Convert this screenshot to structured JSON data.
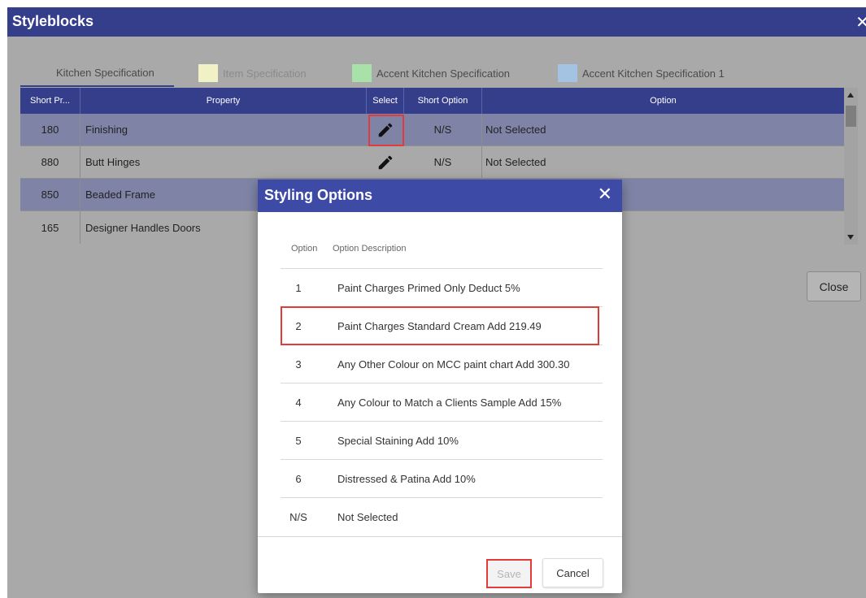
{
  "window": {
    "title": "Styleblocks",
    "close_glyph": "✕"
  },
  "tabs": [
    {
      "label": "Kitchen Specification",
      "color": ""
    },
    {
      "label": "Item Specification",
      "color": "#f1f1c6"
    },
    {
      "label": "Accent Kitchen Specification",
      "color": "#a9e2a9"
    },
    {
      "label": "Accent Kitchen Specification 1",
      "color": "#a4c3e2"
    }
  ],
  "grid": {
    "columns": [
      "Short Pr...",
      "Property",
      "Select",
      "Short Option",
      "Option"
    ],
    "rows": [
      {
        "short": "180",
        "property": "Finishing",
        "short_option": "N/S",
        "option": "Not Selected",
        "selected": true
      },
      {
        "short": "880",
        "property": "Butt Hinges",
        "short_option": "N/S",
        "option": "Not Selected",
        "selected": false
      },
      {
        "short": "850",
        "property": "Beaded Frame",
        "short_option": "",
        "option": "",
        "selected": true
      },
      {
        "short": "165",
        "property": "Designer Handles Doors",
        "short_option": "",
        "option": "",
        "selected": false
      }
    ]
  },
  "close_button": "Close",
  "modal": {
    "title": "Styling Options",
    "close_glyph": "✕",
    "headers": {
      "option": "Option",
      "description": "Option Description"
    },
    "options": [
      {
        "option": "1",
        "description": "Paint Charges Primed Only Deduct 5%"
      },
      {
        "option": "2",
        "description": "Paint Charges Standard Cream Add 219.49"
      },
      {
        "option": "3",
        "description": "Any Other Colour on MCC paint chart Add 300.30"
      },
      {
        "option": "4",
        "description": "Any Colour to Match a Clients Sample Add 15%"
      },
      {
        "option": "5",
        "description": "Special Staining Add 10%"
      },
      {
        "option": "6",
        "description": "Distressed & Patina Add 10%"
      },
      {
        "option": "N/S",
        "description": "Not Selected"
      }
    ],
    "save_label": "Save",
    "cancel_label": "Cancel"
  },
  "colors": {
    "header": "#353e8a",
    "modal_header": "#3d4aa6",
    "highlight": "#e23b3b"
  }
}
